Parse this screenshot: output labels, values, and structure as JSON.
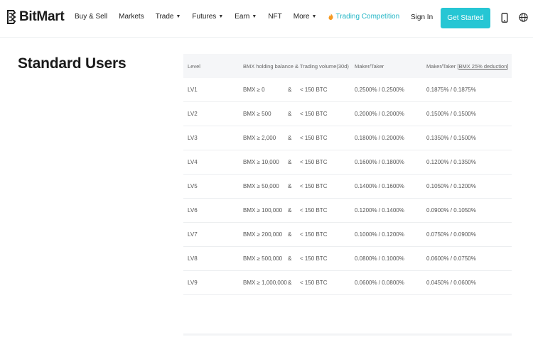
{
  "nav": {
    "brand": "BitMart",
    "items": [
      {
        "label": "Buy & Sell",
        "caret": false
      },
      {
        "label": "Markets",
        "caret": false
      },
      {
        "label": "Trade",
        "caret": true
      },
      {
        "label": "Futures",
        "caret": true
      },
      {
        "label": "Earn",
        "caret": true
      },
      {
        "label": "NFT",
        "caret": false
      },
      {
        "label": "More",
        "caret": true
      }
    ],
    "competition": "Trading Competition",
    "sign_in": "Sign In",
    "get_started": "Get Started",
    "icons": [
      "phone-icon",
      "globe-icon"
    ],
    "accent_color": "#26c6d4"
  },
  "page": {
    "title": "Standard Users"
  },
  "table": {
    "headers": {
      "level": "Level",
      "holding": "BMX holding balance & Trading volume(30d)",
      "fee": "Maker/Taker",
      "fee_deduct_prefix": "Maker/Taker ",
      "fee_deduct_link": "[BMX 25% deduction]"
    },
    "rows": [
      {
        "level": "LV1",
        "bmx": "BMX ≥ 0",
        "amp": "&",
        "volume": "< 150 BTC",
        "fee": "0.2500% / 0.2500%",
        "fee_deduct": "0.1875% / 0.1875%"
      },
      {
        "level": "LV2",
        "bmx": "BMX ≥ 500",
        "amp": "&",
        "volume": "< 150 BTC",
        "fee": "0.2000% / 0.2000%",
        "fee_deduct": "0.1500% / 0.1500%"
      },
      {
        "level": "LV3",
        "bmx": "BMX ≥ 2,000",
        "amp": "&",
        "volume": "< 150 BTC",
        "fee": "0.1800% / 0.2000%",
        "fee_deduct": "0.1350% / 0.1500%"
      },
      {
        "level": "LV4",
        "bmx": "BMX ≥ 10,000",
        "amp": "&",
        "volume": "< 150 BTC",
        "fee": "0.1600% / 0.1800%",
        "fee_deduct": "0.1200% / 0.1350%"
      },
      {
        "level": "LV5",
        "bmx": "BMX ≥ 50,000",
        "amp": "&",
        "volume": "< 150 BTC",
        "fee": "0.1400% / 0.1600%",
        "fee_deduct": "0.1050% / 0.1200%"
      },
      {
        "level": "LV6",
        "bmx": "BMX ≥ 100,000",
        "amp": "&",
        "volume": "< 150 BTC",
        "fee": "0.1200% / 0.1400%",
        "fee_deduct": "0.0900% / 0.1050%"
      },
      {
        "level": "LV7",
        "bmx": "BMX ≥ 200,000",
        "amp": "&",
        "volume": "< 150 BTC",
        "fee": "0.1000% / 0.1200%",
        "fee_deduct": "0.0750% / 0.0900%"
      },
      {
        "level": "LV8",
        "bmx": "BMX ≥ 500,000",
        "amp": "&",
        "volume": "< 150 BTC",
        "fee": "0.0800% / 0.1000%",
        "fee_deduct": "0.0600% / 0.0750%"
      },
      {
        "level": "LV9",
        "bmx": "BMX ≥ 1,000,000",
        "amp": "&",
        "volume": "< 150 BTC",
        "fee": "0.0600% / 0.0800%",
        "fee_deduct": "0.0450% / 0.0600%"
      }
    ]
  }
}
